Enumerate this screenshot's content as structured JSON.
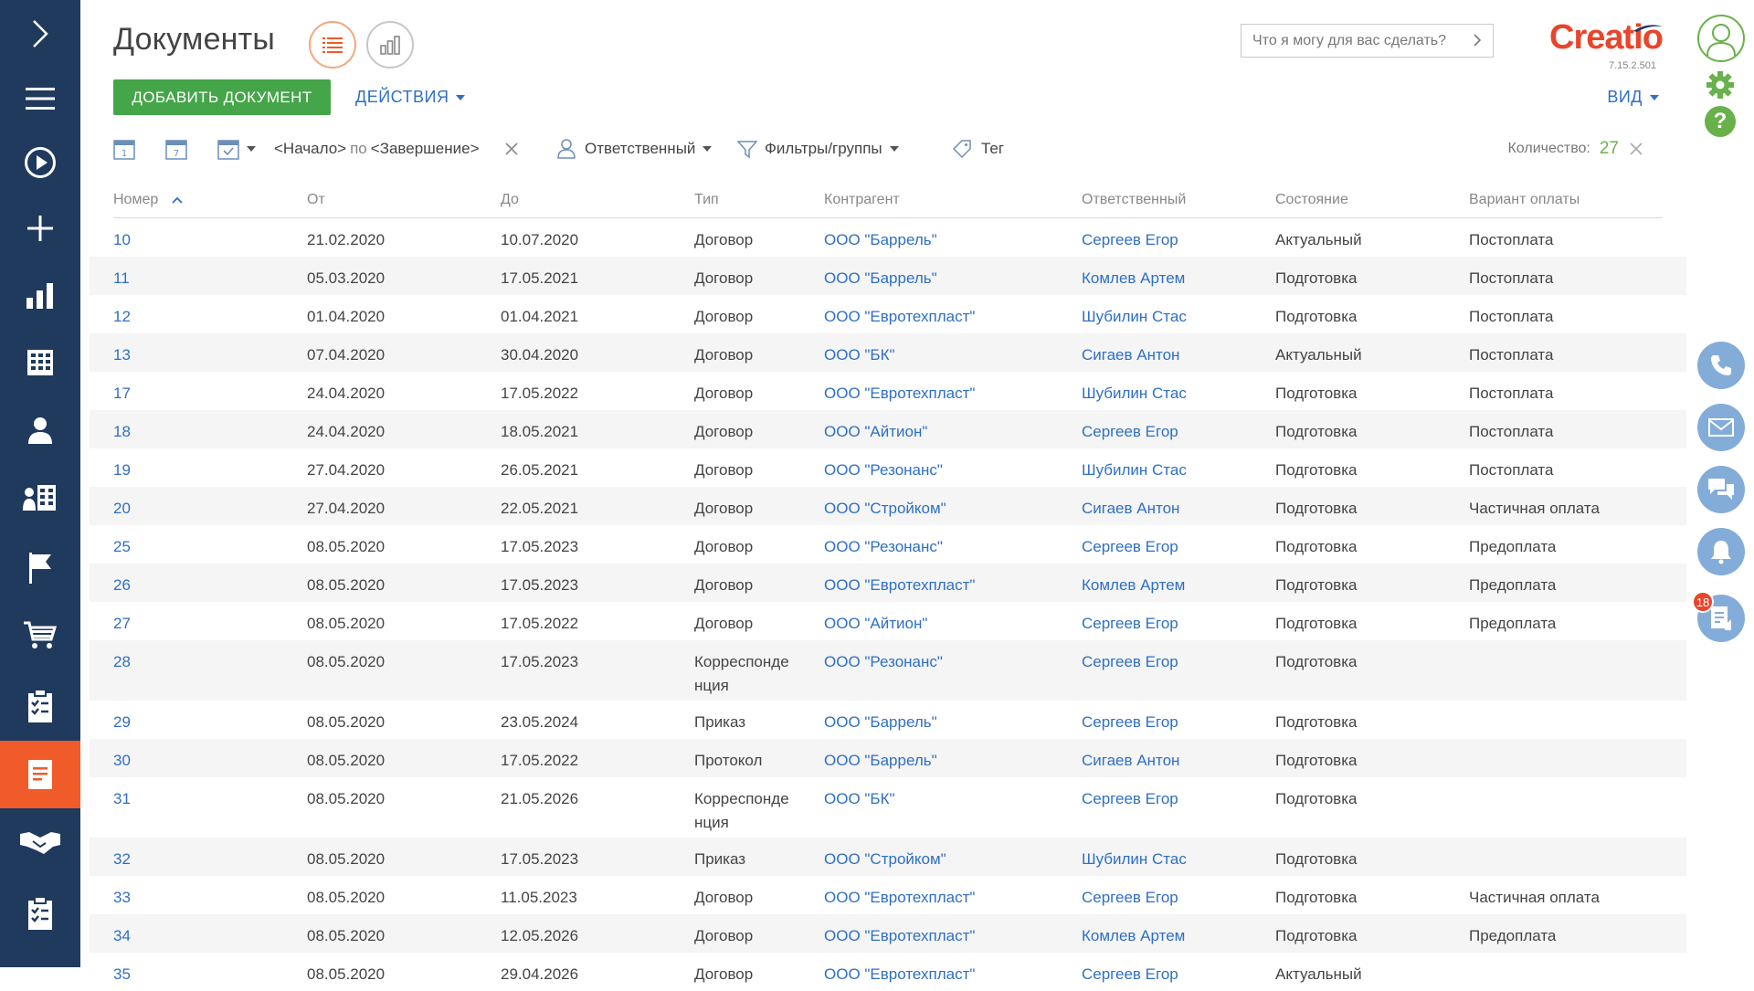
{
  "page": {
    "title": "Документы",
    "add_button": "ДОБАВИТЬ ДОКУМЕНТ",
    "actions_label": "ДЕЙСТВИЯ",
    "view_label": "ВИД",
    "search_placeholder": "Что я могу для вас сделать?",
    "logo_text": "Creatio",
    "version": "7.15.2.501",
    "accent_color": "#f15a29",
    "link_color": "#2e6fc5"
  },
  "sidebar": {
    "items": [
      {
        "icon": "expand-chevron-icon"
      },
      {
        "icon": "menu-icon"
      },
      {
        "icon": "play-icon"
      },
      {
        "icon": "plus-icon"
      },
      {
        "icon": "dashboards-icon"
      },
      {
        "icon": "accounts-building-icon"
      },
      {
        "icon": "contact-person-icon"
      },
      {
        "icon": "organization-icon"
      },
      {
        "icon": "flag-icon"
      },
      {
        "icon": "cart-icon"
      },
      {
        "icon": "checklist-icon"
      },
      {
        "icon": "documents-icon",
        "active": true
      },
      {
        "icon": "handshake-icon"
      },
      {
        "icon": "checklist-icon"
      }
    ]
  },
  "filters": {
    "start": "<Начало>",
    "by": "по",
    "end": "<Завершение>",
    "owner": "Ответственный",
    "filters_groups": "Фильтры/группы",
    "tag": "Тег",
    "count_label": "Количество:",
    "count_value": "27"
  },
  "columns": [
    "Номер",
    "От",
    "До",
    "Тип",
    "Контрагент",
    "Ответственный",
    "Состояние",
    "Вариант оплаты"
  ],
  "rows": [
    {
      "num": "10",
      "from": "21.02.2020",
      "to": "10.07.2020",
      "type": "Договор",
      "account": "ООО \"Баррель\"",
      "owner": "Сергеев Егор",
      "state": "Актуальный",
      "payment": "Постоплата"
    },
    {
      "num": "11",
      "from": "05.03.2020",
      "to": "17.05.2021",
      "type": "Договор",
      "account": "ООО \"Баррель\"",
      "owner": "Комлев Артем",
      "state": "Подготовка",
      "payment": "Постоплата"
    },
    {
      "num": "12",
      "from": "01.04.2020",
      "to": "01.04.2021",
      "type": "Договор",
      "account": "ООО \"Евротехпласт\"",
      "owner": "Шубилин Стас",
      "state": "Подготовка",
      "payment": "Постоплата"
    },
    {
      "num": "13",
      "from": "07.04.2020",
      "to": "30.04.2020",
      "type": "Договор",
      "account": "ООО \"БК\"",
      "owner": "Сигаев Антон",
      "state": "Актуальный",
      "payment": "Постоплата"
    },
    {
      "num": "17",
      "from": "24.04.2020",
      "to": "17.05.2022",
      "type": "Договор",
      "account": "ООО \"Евротехпласт\"",
      "owner": "Шубилин Стас",
      "state": "Подготовка",
      "payment": "Постоплата"
    },
    {
      "num": "18",
      "from": "24.04.2020",
      "to": "18.05.2021",
      "type": "Договор",
      "account": "ООО \"Айтион\"",
      "owner": "Сергеев Егор",
      "state": "Подготовка",
      "payment": "Постоплата"
    },
    {
      "num": "19",
      "from": "27.04.2020",
      "to": "26.05.2021",
      "type": "Договор",
      "account": "ООО \"Резонанс\"",
      "owner": "Шубилин Стас",
      "state": "Подготовка",
      "payment": "Постоплата"
    },
    {
      "num": "20",
      "from": "27.04.2020",
      "to": "22.05.2021",
      "type": "Договор",
      "account": "ООО \"Стройком\"",
      "owner": "Сигаев Антон",
      "state": "Подготовка",
      "payment": "Частичная оплата"
    },
    {
      "num": "25",
      "from": "08.05.2020",
      "to": "17.05.2023",
      "type": "Договор",
      "account": "ООО \"Резонанс\"",
      "owner": "Сергеев Егор",
      "state": "Подготовка",
      "payment": "Предоплата"
    },
    {
      "num": "26",
      "from": "08.05.2020",
      "to": "17.05.2023",
      "type": "Договор",
      "account": "ООО \"Евротехпласт\"",
      "owner": "Комлев Артем",
      "state": "Подготовка",
      "payment": "Предоплата"
    },
    {
      "num": "27",
      "from": "08.05.2020",
      "to": "17.05.2022",
      "type": "Договор",
      "account": "ООО \"Айтион\"",
      "owner": "Сергеев Егор",
      "state": "Подготовка",
      "payment": "Предоплата"
    },
    {
      "num": "28",
      "from": "08.05.2020",
      "to": "17.05.2023",
      "type": "Корреспонде\nнция",
      "account": "ООО \"Резонанс\"",
      "owner": "Сергеев Егор",
      "state": "Подготовка",
      "payment": ""
    },
    {
      "num": "29",
      "from": "08.05.2020",
      "to": "23.05.2024",
      "type": "Приказ",
      "account": "ООО \"Баррель\"",
      "owner": "Сергеев Егор",
      "state": "Подготовка",
      "payment": ""
    },
    {
      "num": "30",
      "from": "08.05.2020",
      "to": "17.05.2022",
      "type": "Протокол",
      "account": "ООО \"Баррель\"",
      "owner": "Сигаев Антон",
      "state": "Подготовка",
      "payment": ""
    },
    {
      "num": "31",
      "from": "08.05.2020",
      "to": "21.05.2026",
      "type": "Корреспонде\nнция",
      "account": "ООО \"БК\"",
      "owner": "Сергеев Егор",
      "state": "Подготовка",
      "payment": ""
    },
    {
      "num": "32",
      "from": "08.05.2020",
      "to": "17.05.2023",
      "type": "Приказ",
      "account": "ООО \"Стройком\"",
      "owner": "Шубилин Стас",
      "state": "Подготовка",
      "payment": ""
    },
    {
      "num": "33",
      "from": "08.05.2020",
      "to": "11.05.2023",
      "type": "Договор",
      "account": "ООО \"Евротехпласт\"",
      "owner": "Сергеев Егор",
      "state": "Подготовка",
      "payment": "Частичная оплата"
    },
    {
      "num": "34",
      "from": "08.05.2020",
      "to": "12.05.2026",
      "type": "Договор",
      "account": "ООО \"Евротехпласт\"",
      "owner": "Комлев Артем",
      "state": "Подготовка",
      "payment": "Предоплата"
    },
    {
      "num": "35",
      "from": "08.05.2020",
      "to": "29.04.2026",
      "type": "Договор",
      "account": "ООО \"Евротехпласт\"",
      "owner": "Сергеев Егор",
      "state": "Актуальный",
      "payment": ""
    }
  ],
  "right_panel": {
    "buttons": [
      {
        "icon": "phone-icon"
      },
      {
        "icon": "email-icon"
      },
      {
        "icon": "chat-icon"
      },
      {
        "icon": "bell-icon"
      },
      {
        "icon": "feed-icon"
      }
    ],
    "badge": "18"
  }
}
